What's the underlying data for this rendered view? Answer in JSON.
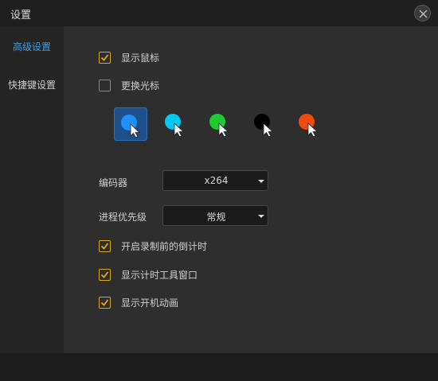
{
  "window": {
    "title": "设置",
    "close_icon": "close-icon"
  },
  "sidebar": {
    "items": [
      {
        "label": "高级设置",
        "active": true
      },
      {
        "label": "快捷键设置",
        "active": false
      }
    ]
  },
  "settings": {
    "show_cursor": {
      "label": "显示鼠标",
      "checked": true
    },
    "change_cursor": {
      "label": "更换光标",
      "checked": false
    },
    "cursor_options": [
      {
        "color": "#1e90ff",
        "selected": true
      },
      {
        "color": "#00c8f0",
        "selected": false
      },
      {
        "color": "#1ecb2f",
        "selected": false
      },
      {
        "color": "#000000",
        "selected": false
      },
      {
        "color": "#f04a10",
        "selected": false
      }
    ],
    "encoder": {
      "label": "编码器",
      "value": "x264"
    },
    "priority": {
      "label": "进程优先级",
      "value": "常规"
    },
    "countdown": {
      "label": "开启录制前的倒计时",
      "checked": true
    },
    "timer_toolbar": {
      "label": "显示计时工具窗口",
      "checked": true
    },
    "startup_animation": {
      "label": "显示开机动画",
      "checked": true
    }
  },
  "colors": {
    "accent": "#3b9ae6",
    "checkbox": "#e0a81e",
    "selected_bg": "#1d4f8a"
  }
}
